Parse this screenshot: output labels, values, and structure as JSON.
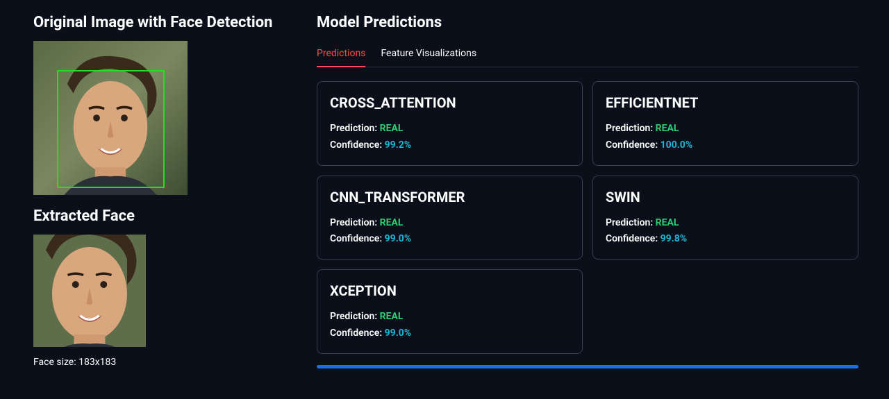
{
  "left": {
    "original_title": "Original Image with Face Detection",
    "extracted_title": "Extracted Face",
    "face_size_text": "Face size: 183x183"
  },
  "right": {
    "section_title": "Model Predictions",
    "tabs": [
      {
        "label": "Predictions",
        "active": true
      },
      {
        "label": "Feature Visualizations",
        "active": false
      }
    ],
    "prediction_label": "Prediction: ",
    "confidence_label": "Confidence: ",
    "models": [
      {
        "name": "CROSS_ATTENTION",
        "prediction": "REAL",
        "confidence": "99.2%"
      },
      {
        "name": "EFFICIENTNET",
        "prediction": "REAL",
        "confidence": "100.0%"
      },
      {
        "name": "CNN_TRANSFORMER",
        "prediction": "REAL",
        "confidence": "99.0%"
      },
      {
        "name": "SWIN",
        "prediction": "REAL",
        "confidence": "99.8%"
      },
      {
        "name": "XCEPTION",
        "prediction": "REAL",
        "confidence": "99.0%"
      }
    ]
  }
}
